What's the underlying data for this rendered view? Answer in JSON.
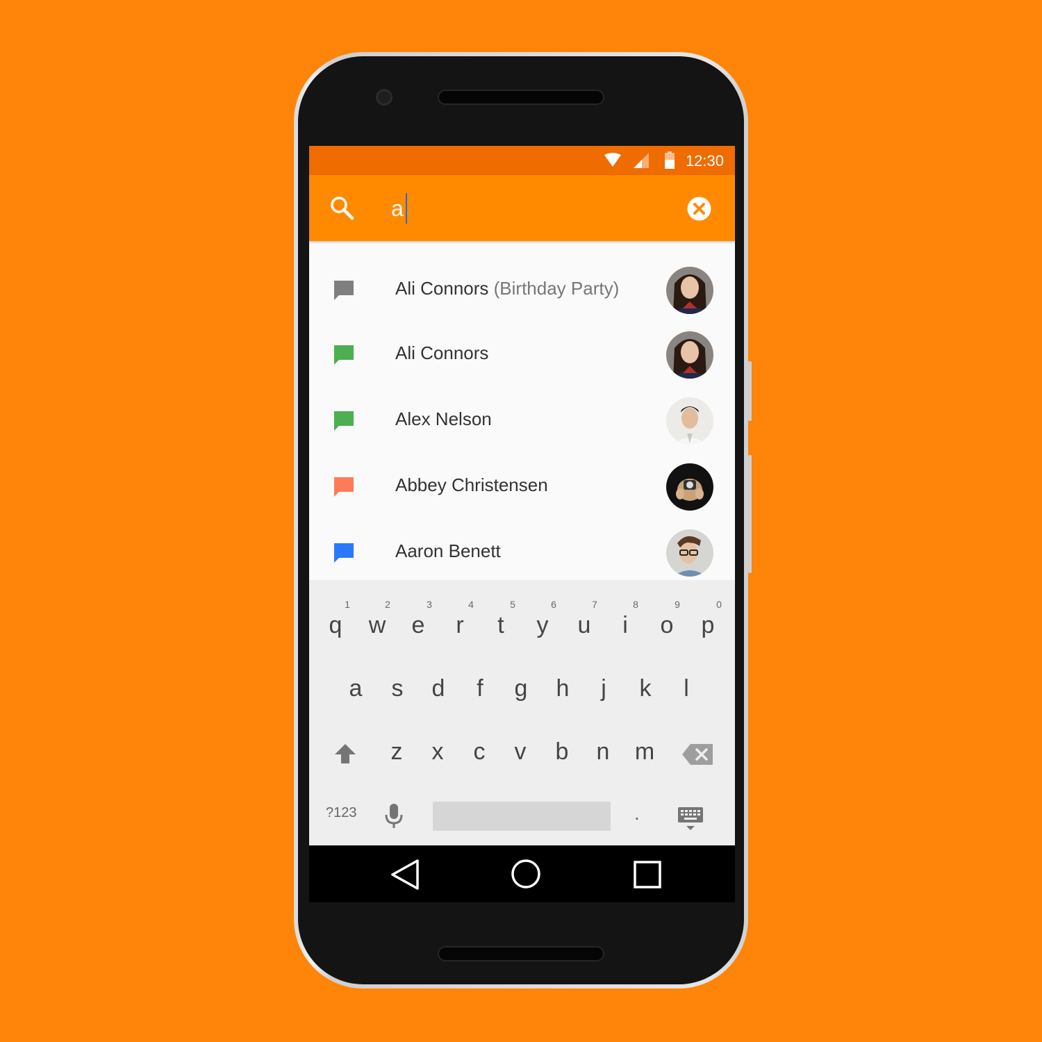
{
  "status_bar": {
    "time": "12:30",
    "icons": [
      "wifi-icon",
      "cell-signal-icon",
      "battery-icon"
    ],
    "color": "#EF6C00"
  },
  "search": {
    "query": "a",
    "icon": "search-icon",
    "clear_icon": "clear-icon",
    "color": "#FF8A00"
  },
  "results": [
    {
      "name": "Ali Connors",
      "detail": "(Birthday Party)",
      "icon_color": "#7F7F7F",
      "avatar": "avatar-ali-connors"
    },
    {
      "name": "Ali Connors",
      "detail": "",
      "icon_color": "#4CAF50",
      "avatar": "avatar-ali-connors"
    },
    {
      "name": "Alex Nelson",
      "detail": "",
      "icon_color": "#4CAF50",
      "avatar": "avatar-alex-nelson"
    },
    {
      "name": "Abbey Christensen",
      "detail": "",
      "icon_color": "#FF7A59",
      "avatar": "avatar-abbey-christensen"
    },
    {
      "name": "Aaron Benett",
      "detail": "",
      "icon_color": "#2979FF",
      "avatar": "avatar-aaron-benett"
    }
  ],
  "keyboard": {
    "row1": [
      "q",
      "w",
      "e",
      "r",
      "t",
      "y",
      "u",
      "i",
      "o",
      "p"
    ],
    "row1_hints": [
      "1",
      "2",
      "3",
      "4",
      "5",
      "6",
      "7",
      "8",
      "9",
      "0"
    ],
    "row2": [
      "a",
      "s",
      "d",
      "f",
      "g",
      "h",
      "j",
      "k",
      "l"
    ],
    "row3": [
      "z",
      "x",
      "c",
      "v",
      "b",
      "n",
      "m"
    ],
    "symbols_label": "?123",
    "period": "."
  },
  "nav": {
    "back_icon": "back-icon",
    "home_icon": "home-icon",
    "recents_icon": "recents-icon"
  },
  "background_color": "#FF840A"
}
